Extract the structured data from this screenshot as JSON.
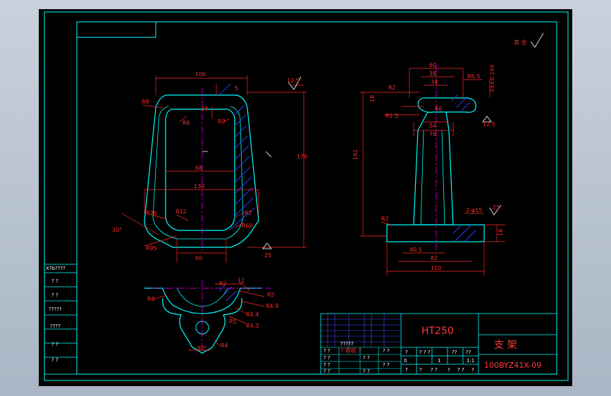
{
  "colors": {
    "background": "#000000",
    "frame": "#00ffff",
    "dimension": "#ff2a2a",
    "outline": "#00ffff",
    "center_line": "#ff00ff",
    "section_hatch": "#2a3cff",
    "text_table": "#ffffff"
  },
  "title_block": {
    "material": "HT250",
    "part_name": "支   架",
    "drawing_code": "100BYZ41X-09",
    "row_labels": [
      "? ?",
      "? ?",
      "? ?",
      "? ?"
    ],
    "design_label": "? ?",
    "check_label": "? ?",
    "scale_row": [
      "?",
      "? ? ?",
      "??",
      "??"
    ],
    "scale_values": [
      "0",
      "1",
      "1:1"
    ],
    "sheet_row": [
      "?",
      "?",
      "? ?",
      "?",
      "? ?",
      "?"
    ],
    "mid_labels": [
      "?????",
      "? ?",
      "? ?"
    ],
    "standard_label": "? 审批 ?"
  },
  "side_table": {
    "header": "X?b????",
    "rows": [
      "? ?",
      "? ?",
      "?????",
      "????",
      "? ?",
      "? ?"
    ]
  },
  "surface_finish_note": "其 余",
  "front_view": {
    "dims": [
      "106",
      "R8",
      "24",
      "5",
      "12.5",
      "R6",
      "R3",
      "68",
      "130",
      "170",
      "R26",
      "R12",
      "R2",
      "R60",
      "30°",
      "R95",
      "60",
      "25"
    ]
  },
  "side_view": {
    "dims": [
      "60",
      "38",
      "34",
      "R6.5",
      "24±0.165",
      "R2",
      "18",
      "R6",
      "R1.5",
      "54",
      "76",
      "12.5",
      "162",
      "R2",
      "2-φ15",
      "25",
      "18",
      "40.5",
      "82",
      "110"
    ]
  },
  "top_view": {
    "dims": [
      "R2",
      "12",
      "R5",
      "R8",
      "R4.9",
      "R4.4",
      "R5",
      "R4.3",
      "40°",
      "R4"
    ]
  }
}
